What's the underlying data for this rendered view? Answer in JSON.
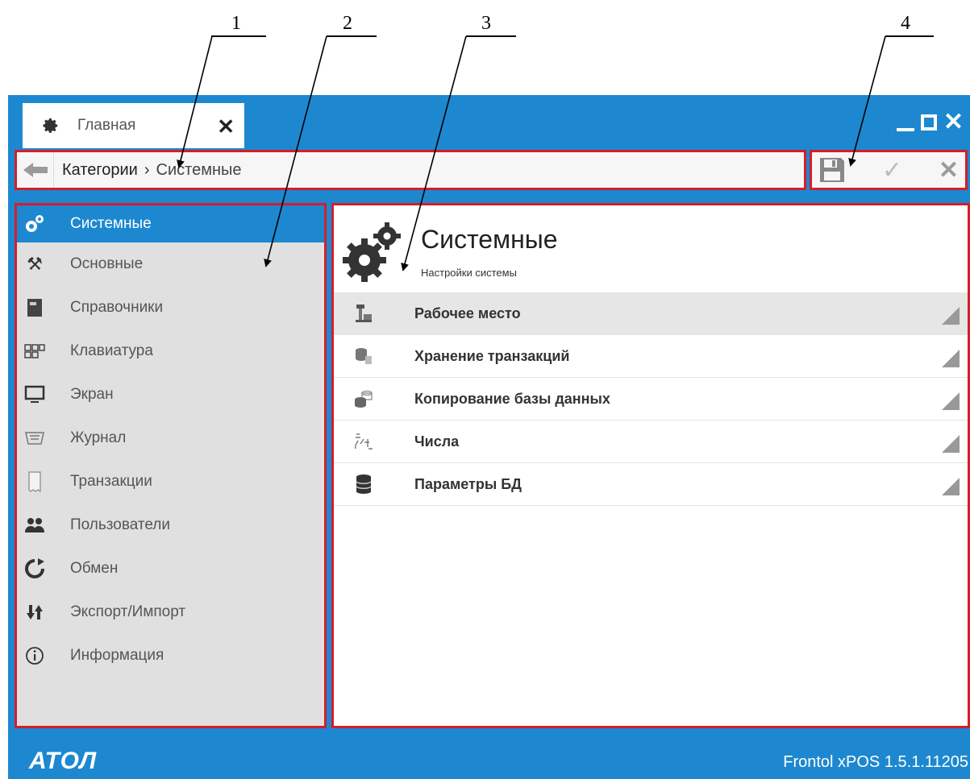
{
  "callouts": [
    "1",
    "2",
    "3",
    "4"
  ],
  "tab": {
    "title": "Главная",
    "icon": "gear-icon"
  },
  "breadcrumb": {
    "root": "Категории",
    "separator": "›",
    "current": "Системные"
  },
  "toolbar": {
    "save_icon": "save-icon",
    "apply_icon": "check-icon",
    "cancel_icon": "close-icon",
    "apply_glyph": "✓",
    "cancel_glyph": "✕"
  },
  "sidebar": {
    "items": [
      {
        "label": "Системные",
        "icon": "system-gear-icon",
        "active": true
      },
      {
        "label": "Основные",
        "icon": "tools-icon"
      },
      {
        "label": "Справочники",
        "icon": "book-icon"
      },
      {
        "label": "Клавиатура",
        "icon": "keyboard-icon"
      },
      {
        "label": "Экран",
        "icon": "monitor-icon"
      },
      {
        "label": "Журнал",
        "icon": "journal-icon"
      },
      {
        "label": "Транзакции",
        "icon": "receipt-icon"
      },
      {
        "label": "Пользователи",
        "icon": "users-icon"
      },
      {
        "label": "Обмен",
        "icon": "sync-icon"
      },
      {
        "label": "Экспорт/Импорт",
        "icon": "export-import-icon"
      },
      {
        "label": "Информация",
        "icon": "info-icon"
      }
    ]
  },
  "main": {
    "title": "Системные",
    "subtitle": "Настройки системы",
    "rows": [
      {
        "label": "Рабочее место",
        "icon": "workstation-icon",
        "selected": true
      },
      {
        "label": "Хранение транзакций",
        "icon": "storage-icon"
      },
      {
        "label": "Копирование базы данных",
        "icon": "db-copy-icon"
      },
      {
        "label": "Числа",
        "icon": "numbers-icon"
      },
      {
        "label": "Параметры БД",
        "icon": "database-icon"
      }
    ]
  },
  "footer": {
    "brand": "АТОЛ",
    "version": "Frontol xPOS 1.5.1.11205"
  },
  "colors": {
    "accent": "#1d88d0",
    "highlight_border": "#d41e2a",
    "sidebar_bg": "#e0e0e0"
  }
}
